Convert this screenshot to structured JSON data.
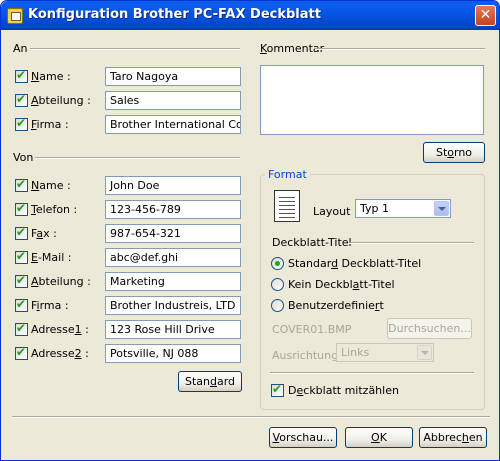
{
  "window": {
    "title": "Konfiguration Brother PC-FAX Deckblatt",
    "close_label": "✕"
  },
  "an": {
    "section_label": "An",
    "rows": [
      {
        "label_pre": "",
        "label_acc": "N",
        "label_post": "ame :",
        "checked": true,
        "value": "Taro Nagoya"
      },
      {
        "label_pre": "",
        "label_acc": "A",
        "label_post": "bteilung :",
        "checked": true,
        "value": "Sales"
      },
      {
        "label_pre": "",
        "label_acc": "F",
        "label_post": "irma :",
        "checked": true,
        "value": "Brother International Corp"
      }
    ]
  },
  "von": {
    "section_label": "Von",
    "rows": [
      {
        "label_pre": "",
        "label_acc": "N",
        "label_post": "ame :",
        "checked": true,
        "value": "John Doe"
      },
      {
        "label_pre": "",
        "label_acc": "T",
        "label_post": "elefon :",
        "checked": true,
        "value": "123-456-789"
      },
      {
        "label_pre": "F",
        "label_acc": "a",
        "label_post": "x :",
        "checked": true,
        "value": "987-654-321"
      },
      {
        "label_pre": "",
        "label_acc": "E",
        "label_post": "-Mail :",
        "checked": true,
        "value": "abc@def.ghi"
      },
      {
        "label_pre": "",
        "label_acc": "A",
        "label_post": "bteilung :",
        "checked": true,
        "value": "Marketing"
      },
      {
        "label_pre": "F",
        "label_acc": "i",
        "label_post": "rma :",
        "checked": true,
        "value": "Brother Industreis, LTD"
      },
      {
        "label_pre": "Adresse",
        "label_acc": "1",
        "label_post": " :",
        "checked": true,
        "value": "123 Rose Hill Drive"
      },
      {
        "label_pre": "Adresse",
        "label_acc": "2",
        "label_post": " :",
        "checked": true,
        "value": "Potsville, NJ 088"
      }
    ],
    "standard_button": {
      "pre": "Stan",
      "acc": "d",
      "post": "ard"
    }
  },
  "kommentar": {
    "section_label_pre": "",
    "section_label_acc": "K",
    "section_label_post": "ommentar",
    "value": "",
    "storno_button": {
      "pre": "St",
      "acc": "o",
      "post": "rno"
    }
  },
  "format": {
    "legend": "Format",
    "layout_label": "Layout",
    "layout_value": "Typ 1",
    "deckblatt_titel_label": "Deckblatt-Titel",
    "radios": [
      {
        "pre": "Standar",
        "acc": "d",
        "post": " Deckblatt-Titel",
        "selected": true
      },
      {
        "pre": "Kein Deckbl",
        "acc": "a",
        "post": "tt-Titel",
        "selected": false
      },
      {
        "pre": "Benutzerdefinie",
        "acc": "r",
        "post": "t",
        "selected": false
      }
    ],
    "file_value": "COVER01.BMP",
    "browse_button": "Durchsuchen...",
    "ausrichtung_label": "Ausrichtung",
    "ausrichtung_value": "Links",
    "count_checkbox": {
      "pre": "D",
      "acc": "e",
      "post": "ckblatt mitzählen",
      "checked": true
    }
  },
  "footer": {
    "preview_button": {
      "pre": "",
      "acc": "V",
      "post": "orschau..."
    },
    "ok_button": {
      "pre": "",
      "acc": "O",
      "post": "K"
    },
    "cancel_button": {
      "pre": "Abbrec",
      "acc": "h",
      "post": "en"
    }
  },
  "colors": {
    "titlebar": "#0553e0",
    "dialog_bg": "#ece9d8",
    "group_legend": "#0046d5",
    "checkmark": "#21a121"
  },
  "icons": {
    "close": "close-icon",
    "document": "document-icon",
    "dropdown": "chevron-down-icon",
    "app": "fax-app-icon"
  }
}
